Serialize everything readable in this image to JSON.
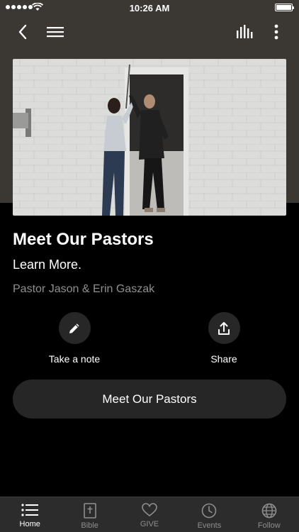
{
  "status_bar": {
    "time": "10:26 AM",
    "signal_dots": 5
  },
  "header": {
    "back_icon": "chevron-left-icon",
    "menu_icon": "hamburger-icon",
    "bars_icon": "equalizer-icon",
    "more_icon": "vertical-ellipsis-icon"
  },
  "content": {
    "title": "Meet Our Pastors",
    "subtitle": "Learn More.",
    "speaker": "Pastor Jason & Erin Gaszak"
  },
  "actions": {
    "note_label": "Take a note",
    "share_label": "Share"
  },
  "cta_label": "Meet Our Pastors",
  "tabs": [
    {
      "label": "Home",
      "icon": "list-icon",
      "active": true
    },
    {
      "label": "Bible",
      "icon": "bible-icon",
      "active": false
    },
    {
      "label": "GIVE",
      "icon": "heart-icon",
      "active": false
    },
    {
      "label": "Events",
      "icon": "clock-icon",
      "active": false
    },
    {
      "label": "Follow",
      "icon": "globe-icon",
      "active": false
    }
  ],
  "colors": {
    "header_bg": "#3b3733",
    "background": "#000000",
    "button_bg": "#262626",
    "tabbar_bg": "#2c2c2c",
    "muted_text": "#8f8f8f"
  }
}
